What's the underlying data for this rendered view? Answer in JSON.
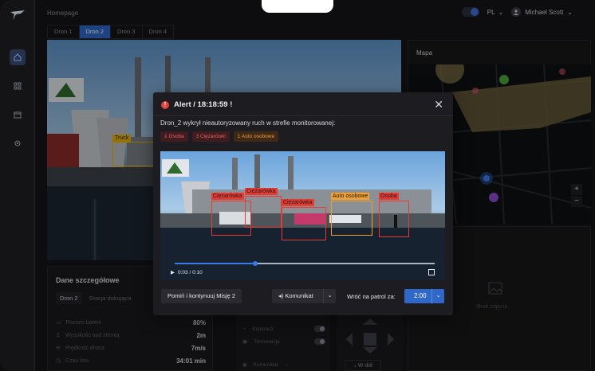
{
  "header": {
    "breadcrumb": "Homepage",
    "language": "PL",
    "user_name": "Michael Scott"
  },
  "tabs": [
    {
      "label": "Dron 1",
      "active": false
    },
    {
      "label": "Dron 2",
      "active": true
    },
    {
      "label": "Dron 3",
      "active": false
    },
    {
      "label": "Dron 4",
      "active": false
    }
  ],
  "main_video": {
    "detection_label": "Truck"
  },
  "map": {
    "title": "Mapa",
    "zoom_in": "+",
    "zoom_out": "−"
  },
  "image_placeholder": {
    "label": "Brak zdjęcia"
  },
  "details": {
    "title": "Dane szczegółowe",
    "tabs": [
      {
        "label": "Dron 2",
        "active": true
      },
      {
        "label": "Stacja dokująca",
        "active": false
      }
    ],
    "rows": [
      {
        "label": "Poziom baterii",
        "value": "80%"
      },
      {
        "label": "Wysokość nad ziemią",
        "value": "2m"
      },
      {
        "label": "Prędkość drona",
        "value": "7m/s"
      },
      {
        "label": "Czas lotu",
        "value": "34:01 min"
      }
    ]
  },
  "controls": {
    "rows": [
      {
        "label": "Szperacz"
      },
      {
        "label": "Termowizja"
      }
    ],
    "komunikat_label": "Komunikat",
    "down_label": "W dół"
  },
  "alert": {
    "title": "Alert / 18:18:59 !",
    "message": "Dron_2 wykrył nieautoryzowany ruch w strefie monitorowanej:",
    "chips": [
      {
        "label": "1 Osoba",
        "color": "#f0605a"
      },
      {
        "label": "3 Ciężarówki",
        "color": "#f0605a"
      },
      {
        "label": "1 Auto osobowe",
        "color": "#f29a3c"
      }
    ],
    "video": {
      "detections": [
        "Ciężarówka",
        "Ciężarówka",
        "Ciężarówka",
        "Auto osobowe",
        "Osoba"
      ],
      "time": "0:03 / 0:10",
      "progress": 0.31
    },
    "skip_button": "Pomiń i kontynuuj Misję 2",
    "komunikat_button": "Komunikat",
    "patrol_label": "Wróć na patrol za:",
    "patrol_time": "2:00"
  },
  "colors": {
    "accent": "#2f68c8",
    "alert_red": "#e0413b",
    "detection_red": "#e63a33",
    "detection_orange": "#f0a030",
    "detection_yellow": "#e8b300"
  }
}
